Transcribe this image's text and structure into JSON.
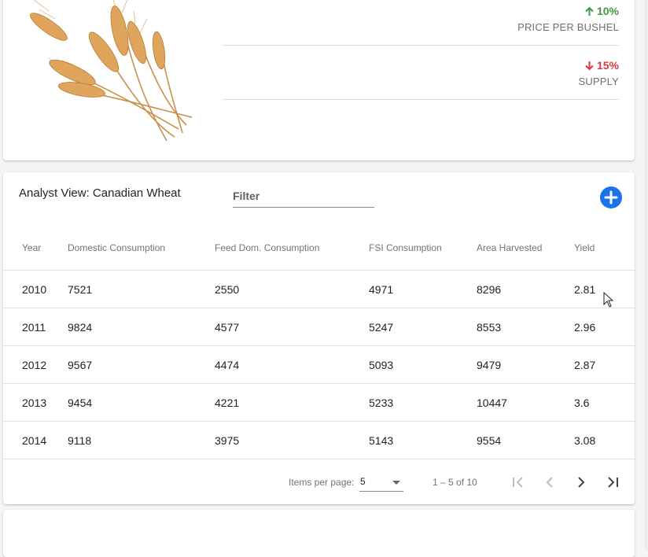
{
  "stats": [
    {
      "direction": "up",
      "change": "10%",
      "label": "PRICE PER BUSHEL"
    },
    {
      "direction": "down",
      "change": "15%",
      "label": "SUPPLY"
    }
  ],
  "colors": {
    "up": "#3d9a3d",
    "down": "#d23b3b",
    "accent": "#1a73e8"
  },
  "analyst": {
    "title": "Analyst View: Canadian Wheat",
    "filter_placeholder": "Filter",
    "add_icon": "add-circle-icon"
  },
  "table": {
    "columns": [
      "Year",
      "Domestic Consumption",
      "Feed Dom. Consumption",
      "FSI Consumption",
      "Area Harvested",
      "Yield"
    ],
    "rows": [
      [
        "2010",
        "7521",
        "2550",
        "4971",
        "8296",
        "2.81"
      ],
      [
        "2011",
        "9824",
        "4577",
        "5247",
        "8553",
        "2.96"
      ],
      [
        "2012",
        "9567",
        "4474",
        "5093",
        "9479",
        "2.87"
      ],
      [
        "2013",
        "9454",
        "4221",
        "5233",
        "10447",
        "3.6"
      ],
      [
        "2014",
        "9118",
        "3975",
        "5143",
        "9554",
        "3.08"
      ]
    ]
  },
  "paginator": {
    "items_per_page_label": "Items per page:",
    "items_per_page_value": "5",
    "range_label": "1 – 5 of 10"
  }
}
